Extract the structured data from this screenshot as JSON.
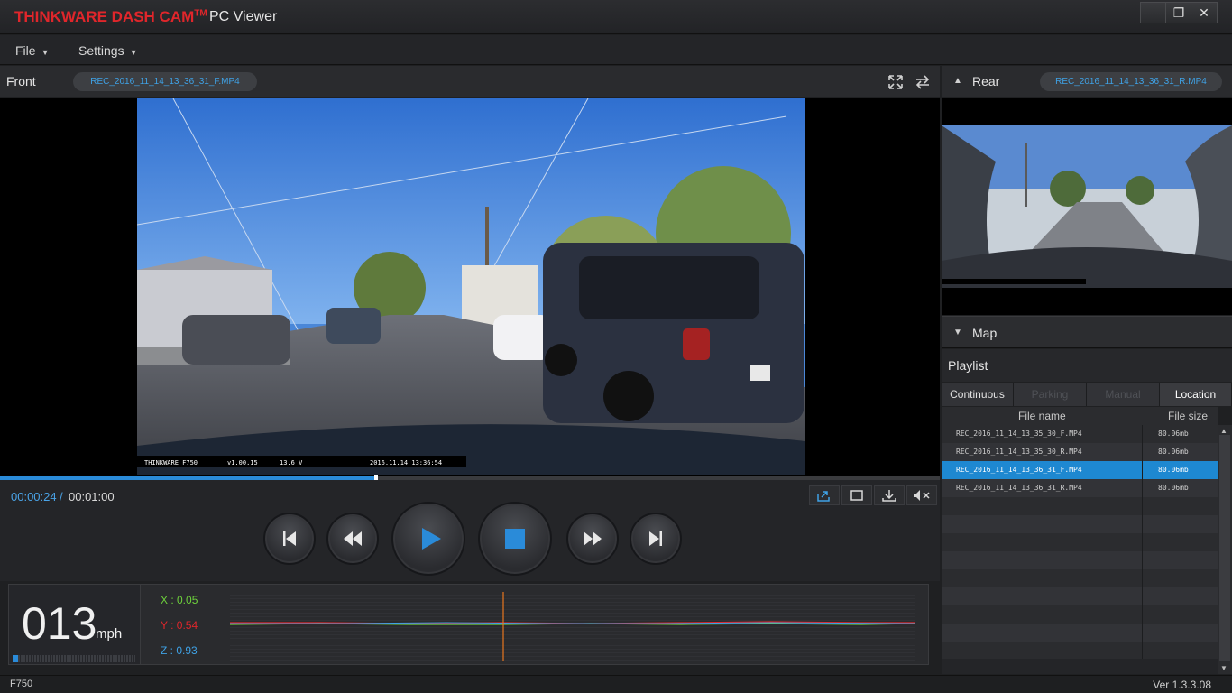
{
  "window": {
    "brand": "THINKWARE DASH CAM",
    "brand_tm": "TM",
    "app_name": "PC Viewer",
    "minimize": "–",
    "restore": "❐",
    "close": "✕"
  },
  "menu": {
    "file": "File",
    "settings": "Settings"
  },
  "front": {
    "label": "Front",
    "filename": "REC_2016_11_14_13_36_31_F.MP4",
    "osd": {
      "model": "THINKWARE F750",
      "version": "v1.00.15",
      "voltage": "13.6 V",
      "datetime": "2016.11.14 13:36:54"
    }
  },
  "rear": {
    "label": "Rear",
    "filename": "REC_2016_11_14_13_36_31_R.MP4"
  },
  "playback": {
    "current_time": "00:00:24",
    "separator": "/",
    "total_time": "00:01:00",
    "progress_fraction": 0.4
  },
  "toolbar": {
    "share_icon": "share-icon",
    "fullscreen_icon": "square-icon",
    "save_icon": "download-icon",
    "mute_icon": "mute-icon"
  },
  "sensor": {
    "speed": "013",
    "speed_unit": "mph",
    "x_label": "X : 0.05",
    "y_label": "Y : 0.54",
    "z_label": "Z : 0.93",
    "x_color": "#6ed23c",
    "y_color": "#e0262b",
    "z_color": "#3fa2e6"
  },
  "map": {
    "label": "Map"
  },
  "playlist": {
    "label": "Playlist",
    "tabs": [
      {
        "label": "Continuous"
      },
      {
        "label": "Parking"
      },
      {
        "label": "Manual"
      },
      {
        "label": "Location"
      }
    ],
    "columns": {
      "file_name": "File name",
      "file_size": "File size"
    },
    "rows": [
      {
        "name": "REC_2016_11_14_13_35_30_F.MP4",
        "size": "80.06mb"
      },
      {
        "name": "REC_2016_11_14_13_35_30_R.MP4",
        "size": "80.06mb"
      },
      {
        "name": "REC_2016_11_14_13_36_31_F.MP4",
        "size": "80.06mb"
      },
      {
        "name": "REC_2016_11_14_13_36_31_R.MP4",
        "size": "80.06mb"
      }
    ]
  },
  "status": {
    "model": "F750",
    "version": "Ver 1.3.3.08"
  },
  "colors": {
    "accent": "#2a8bd9",
    "brand_red": "#e0262b",
    "selected_row": "#1e88d1"
  }
}
